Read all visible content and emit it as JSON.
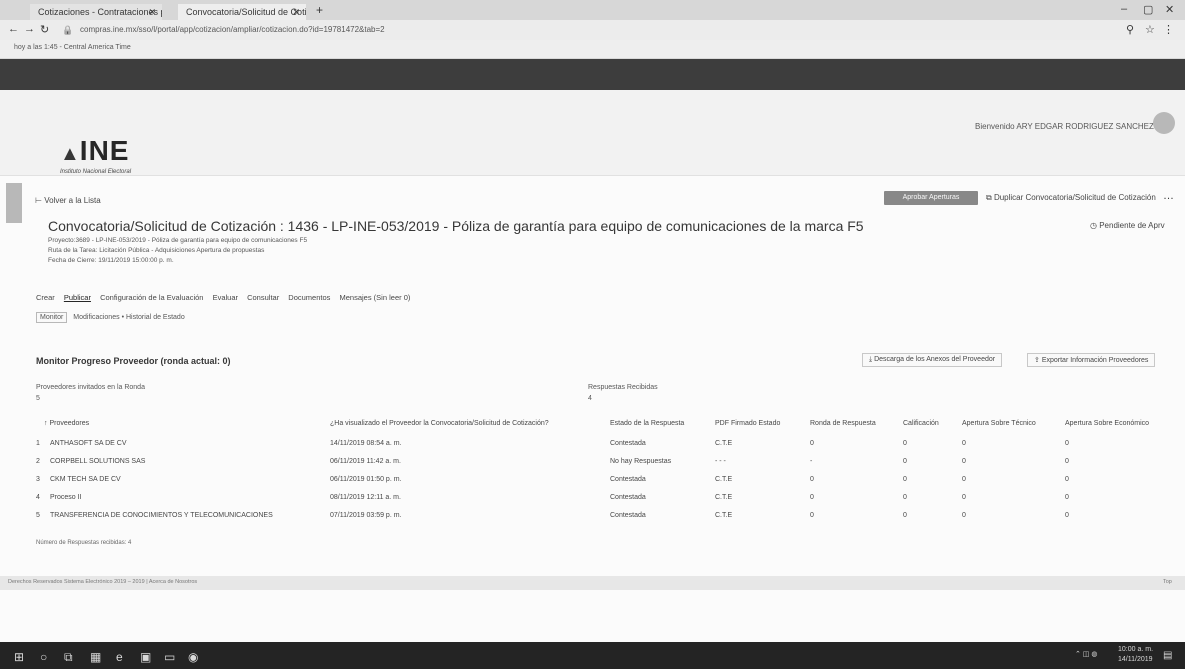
{
  "browser": {
    "tabs": [
      {
        "label": "Cotizaciones - Contrataciones pú"
      },
      {
        "label": "Convocatoria/Solicitud de Cotiz"
      }
    ],
    "url": "compras.ine.mx/sso/l/portal/app/cotizacion/ampliar/cotizacion.do?id=19781472&tab=2",
    "bookmark": "hoy a las 1:45 - Central America Time",
    "window_min": "–",
    "window_max": "▢",
    "window_close": "✕"
  },
  "header": {
    "logo_text": "INE",
    "logo_sub": "Instituto Nacional Electoral",
    "welcome": "Bienvenido ARY EDGAR RODRIGUEZ SANCHEZ"
  },
  "toolbar": {
    "back_label": "Volver a la Lista",
    "primary_action": "Aprobar Aperturas",
    "link_action": "Duplicar Convocatoria/Solicitud de Cotización",
    "more": "…"
  },
  "page": {
    "title": "Convocatoria/Solicitud de Cotización : 1436 - LP-INE-053/2019 - Póliza de garantía para equipo de comunicaciones de la marca F5",
    "status": "Pendiente de Aprv",
    "meta": [
      "Proyecto:3689 - LP-INE-053/2019 - Póliza de garantía para equipo de comunicaciones F5",
      "Ruta de la Tarea: Licitación Pública - Adquisiciones Apertura de propuestas",
      "Fecha de Cierre: 19/11/2019 15:00:00 p. m."
    ]
  },
  "tabs": [
    {
      "label": "Crear",
      "active": false
    },
    {
      "label": "Publicar",
      "active": true
    },
    {
      "label": "Configuración de la Evaluación",
      "active": false
    },
    {
      "label": "Evaluar",
      "active": false
    },
    {
      "label": "Consultar",
      "active": false
    },
    {
      "label": "Documentos",
      "active": false
    },
    {
      "label": "Mensajes (Sin leer 0)",
      "active": false
    }
  ],
  "subnav": {
    "monitor": "Monitor",
    "modificaciones": "Modificaciones",
    "separator": "•",
    "historial": "Historial de Estado"
  },
  "section": {
    "title": "Monitor Progreso Proveedor (ronda actual: 0)",
    "download_btn": "Descarga de los Anexos del Proveedor",
    "export_btn": "Exportar Información Proveedores",
    "invited_label": "Proveedores invitados en la Ronda",
    "invited_value": "5",
    "responses_label": "Respuestas Recibidas",
    "responses_value": "4"
  },
  "table": {
    "headers": [
      "↑ Proveedores",
      "¿Ha visualizado el Proveedor la Convocatoria/Solicitud de Cotización?",
      "Estado de la Respuesta",
      "PDF Firmado Estado",
      "Ronda de Respuesta",
      "Calificación",
      "Apertura Sobre Técnico",
      "Apertura Sobre Económico"
    ],
    "rows": [
      {
        "n": "1",
        "name": "ANTHASOFT SA DE CV",
        "viewed": "14/11/2019 08:54 a. m.",
        "estado": "Contestada",
        "pdf": "C.T.E",
        "ronda": "0",
        "calif": "0",
        "tec": "0",
        "eco": "0"
      },
      {
        "n": "2",
        "name": "CORPBELL SOLUTIONS SAS",
        "viewed": "06/11/2019 11:42 a. m.",
        "estado": "No hay Respuestas",
        "pdf": "- - -",
        "ronda": "-",
        "calif": "0",
        "tec": "0",
        "eco": "0"
      },
      {
        "n": "3",
        "name": "CKM TECH SA DE CV",
        "viewed": "06/11/2019 01:50 p. m.",
        "estado": "Contestada",
        "pdf": "C.T.E",
        "ronda": "0",
        "calif": "0",
        "tec": "0",
        "eco": "0"
      },
      {
        "n": "4",
        "name": "Proceso II",
        "viewed": "08/11/2019 12:11 a. m.",
        "estado": "Contestada",
        "pdf": "C.T.E",
        "ronda": "0",
        "calif": "0",
        "tec": "0",
        "eco": "0"
      },
      {
        "n": "5",
        "name": "TRANSFERENCIA DE CONOCIMIENTOS Y TELECOMUNICACIONES",
        "viewed": "07/11/2019 03:59 p. m.",
        "estado": "Contestada",
        "pdf": "C.T.E",
        "ronda": "0",
        "calif": "0",
        "tec": "0",
        "eco": "0"
      }
    ],
    "footer": "Número de Respuestas recibidas: 4"
  },
  "bottom_strip": {
    "left": "Derechos Reservados Sistema Electrónico 2019 – 2019 | Acerca de Nosotros",
    "right": "Top"
  },
  "taskbar": {
    "time": "10:00 a. m.",
    "date": "14/11/2019"
  }
}
